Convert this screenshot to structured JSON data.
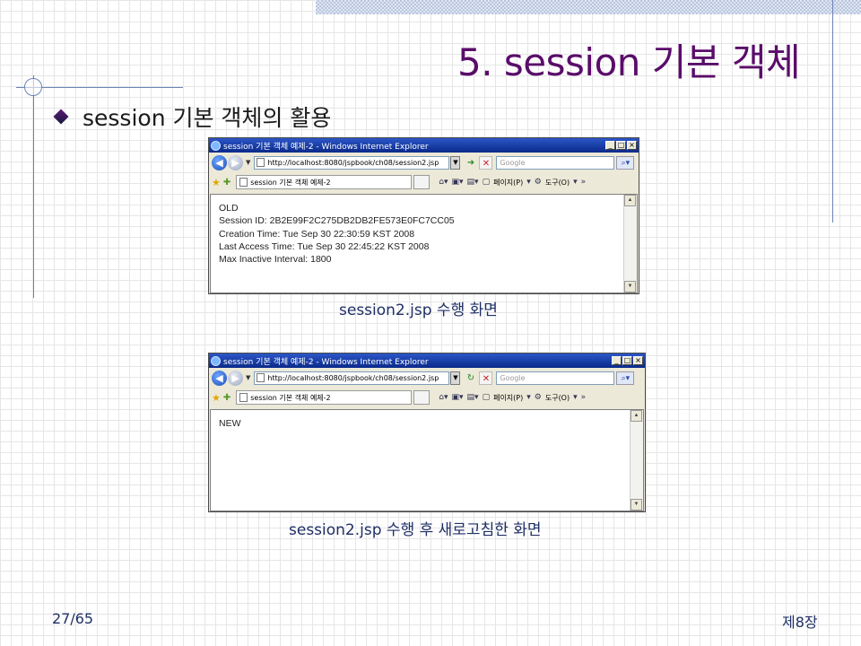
{
  "slide": {
    "title": "5. session 기본 객체",
    "bullet": "session 기본 객체의 활용",
    "page_number": "27/65",
    "chapter": "제8장"
  },
  "windows": [
    {
      "title": "session 기본 객체 예제-2 - Windows Internet Explorer",
      "url": "http://localhost:8080/jspbook/ch08/session2.jsp",
      "search_placeholder": "Google",
      "tab_label": "session 기본 객체 예제-2",
      "cmd_page": "페이지(P)",
      "cmd_tools": "도구(O)",
      "content_lines": [
        "OLD",
        "Session ID: 2B2E99F2C275DB2DB2FE573E0FC7CC05",
        "Creation Time: Tue Sep 30 22:30:59 KST 2008",
        "Last Access Time: Tue Sep 30 22:45:22 KST 2008",
        "Max Inactive Interval: 1800"
      ],
      "caption": "session2.jsp 수행 화면"
    },
    {
      "title": "session 기본 객체 예제-2 - Windows Internet Explorer",
      "url": "http://localhost:8080/jspbook/ch08/session2.jsp",
      "search_placeholder": "Google",
      "tab_label": "session 기본 객체 예제-2",
      "cmd_page": "페이지(P)",
      "cmd_tools": "도구(O)",
      "content_lines": [
        "NEW"
      ],
      "caption": "session2.jsp 수행 후 새로고침한 화면"
    }
  ]
}
